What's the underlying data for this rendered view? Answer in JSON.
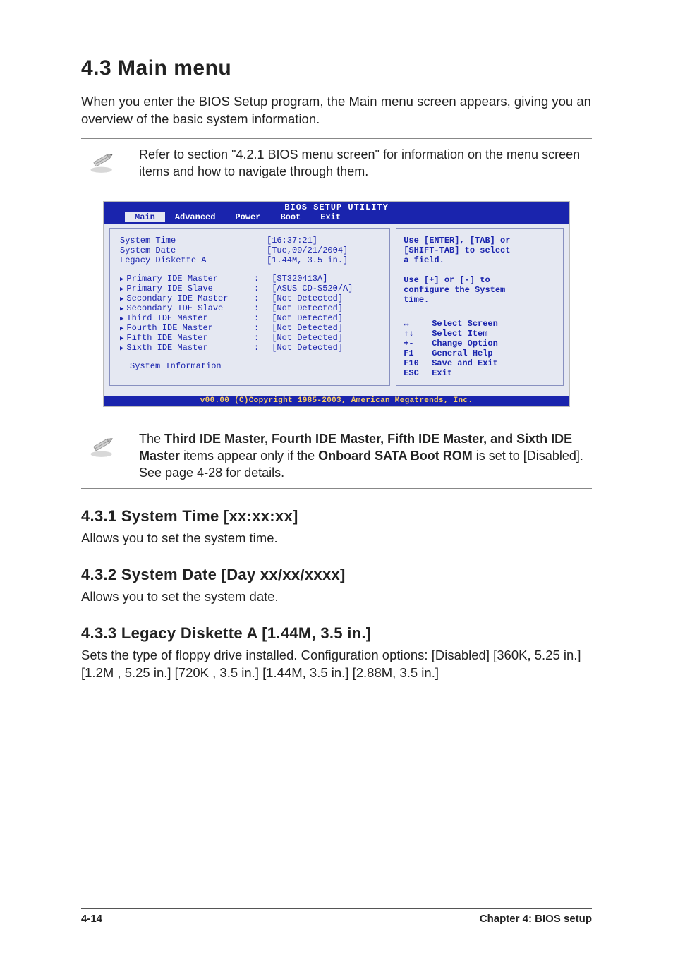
{
  "heading": {
    "number_title": "4.3     Main menu",
    "intro": "When you enter the BIOS Setup program, the Main menu screen appears, giving you an overview of the basic system information."
  },
  "note1": {
    "text": "Refer to section \"4.2.1  BIOS menu screen\" for information on the menu screen items and how to navigate through them."
  },
  "bios": {
    "title": "BIOS SETUP UTILITY",
    "tabs": [
      "Main",
      "Advanced",
      "Power",
      "Boot",
      "Exit"
    ],
    "active_tab": "Main",
    "rows_top": [
      {
        "label": "System Time",
        "colon": "",
        "val": "[16:37:21]"
      },
      {
        "label": "System Date",
        "colon": "",
        "val": "[Tue,09/21/2004]"
      },
      {
        "label": "Legacy Diskette A",
        "colon": "",
        "val": "[1.44M, 3.5 in.]"
      }
    ],
    "rows_ide": [
      {
        "label": "Primary IDE Master",
        "val": "[ST320413A]"
      },
      {
        "label": "Primary IDE Slave",
        "val": "[ASUS CD-S520/A]"
      },
      {
        "label": "Secondary IDE Master",
        "val": "[Not Detected]"
      },
      {
        "label": "Secondary IDE Slave",
        "val": "[Not Detected]"
      },
      {
        "label": "Third IDE Master",
        "val": "[Not Detected]"
      },
      {
        "label": "Fourth IDE Master",
        "val": "[Not Detected]"
      },
      {
        "label": "Fifth IDE Master",
        "val": "[Not Detected]"
      },
      {
        "label": "Sixth IDE Master",
        "val": "[Not Detected]"
      }
    ],
    "sysinfo": "System Information",
    "help_top": "Use [ENTER], [TAB] or\n[SHIFT-TAB] to select\na field.\n\nUse [+] or [-] to\nconfigure the System\ntime.",
    "nav": [
      {
        "k": "↔",
        "v": "Select Screen"
      },
      {
        "k": "↑↓",
        "v": "Select Item"
      },
      {
        "k": "+-",
        "v": "Change Option"
      },
      {
        "k": "F1",
        "v": "General Help"
      },
      {
        "k": "F10",
        "v": "Save and Exit"
      },
      {
        "k": "ESC",
        "v": "Exit"
      }
    ],
    "footer": "v00.00 (C)Copyright 1985-2003, American Megatrends, Inc."
  },
  "note2": {
    "pre": "The ",
    "bold1": "Third IDE Master, Fourth IDE Master, Fifth IDE Master, and Sixth IDE Master",
    "mid1": " items appear only if the ",
    "bold2": "Onboard SATA Boot ROM",
    "post": " is set to [Disabled]. See page 4-28 for details."
  },
  "subs": [
    {
      "title": "4.3.1   System Time [xx:xx:xx]",
      "text": "Allows you to set the system time."
    },
    {
      "title": "4.3.2   System Date [Day xx/xx/xxxx]",
      "text": "Allows you to set the system date."
    },
    {
      "title": "4.3.3   Legacy Diskette A [1.44M, 3.5 in.]",
      "text": "Sets the type of floppy drive installed. Configuration options: [Disabled] [360K, 5.25 in.] [1.2M , 5.25 in.] [720K , 3.5 in.] [1.44M, 3.5 in.] [2.88M, 3.5 in.]"
    }
  ],
  "footer": {
    "left": "4-14",
    "right": "Chapter 4: BIOS setup"
  }
}
